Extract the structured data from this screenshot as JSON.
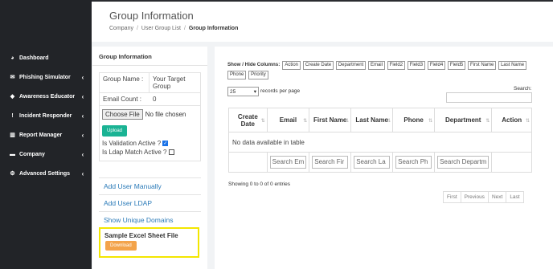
{
  "sidebar": {
    "items": [
      {
        "label": "Dashboard",
        "icon": "dashboard-icon",
        "glyph": "◕",
        "chevron": ""
      },
      {
        "label": "Phishing Simulator",
        "icon": "envelope-icon",
        "glyph": "✉",
        "chevron": "‹"
      },
      {
        "label": "Awareness Educator",
        "icon": "graduation-cap-icon",
        "glyph": "◆",
        "chevron": "‹"
      },
      {
        "label": "Incident Responder",
        "icon": "alert-icon",
        "glyph": "!",
        "chevron": "‹"
      },
      {
        "label": "Report Manager",
        "icon": "chart-icon",
        "glyph": "▥",
        "chevron": "‹"
      },
      {
        "label": "Company",
        "icon": "briefcase-icon",
        "glyph": "▬",
        "chevron": "‹"
      },
      {
        "label": "Advanced Settings",
        "icon": "gears-icon",
        "glyph": "⚙",
        "chevron": "‹"
      }
    ]
  },
  "header": {
    "title": "Group Information",
    "breadcrumb": [
      "Company",
      "User Group List",
      "Group Information"
    ],
    "separator": "/"
  },
  "group_panel": {
    "title": "Group Information",
    "group_name_label": "Group Name :",
    "group_name_value": "Your Target Group",
    "email_count_label": "Email Count :",
    "email_count_value": "0",
    "choose_file_label": "Choose File",
    "no_file_text": "No file chosen",
    "upload_label": "Upload",
    "validation_label": "Is Validation Active ?",
    "validation_checked": true,
    "ldap_label": "Is Ldap Match Active ?",
    "ldap_checked": false,
    "add_user_manually": "Add User Manually",
    "add_user_ldap": "Add User LDAP",
    "show_unique_domains": "Show Unique Domains",
    "sample_title": "Sample Excel Sheet File",
    "download_label": "Download"
  },
  "table_panel": {
    "show_hide_label": "Show / Hide Columns:",
    "column_toggles": [
      "Action",
      "Create Date",
      "Department",
      "Email",
      "Field2",
      "Field3",
      "Field4",
      "Field5",
      "First Name",
      "Last Name",
      "Phone",
      "Priority"
    ],
    "page_length": "25",
    "records_label": "records per page",
    "search_label": "Search:",
    "columns": [
      "Create Date",
      "Email",
      "First Name",
      "Last Name",
      "Phone",
      "Department",
      "Action"
    ],
    "empty_text": "No data available in table",
    "filter_placeholders": [
      "Search Em",
      "Search Fir",
      "Search La",
      "Search Ph",
      "Search Departm"
    ],
    "info_text": "Showing 0 to 0 of 0 entries",
    "pager": [
      "First",
      "Previous",
      "Next",
      "Last"
    ]
  },
  "colors": {
    "sidebar_bg": "#222428",
    "upload_button": "#1ab394",
    "download_button": "#f3a34a",
    "highlight_box": "#f3e600",
    "link": "#2a7ab8"
  }
}
